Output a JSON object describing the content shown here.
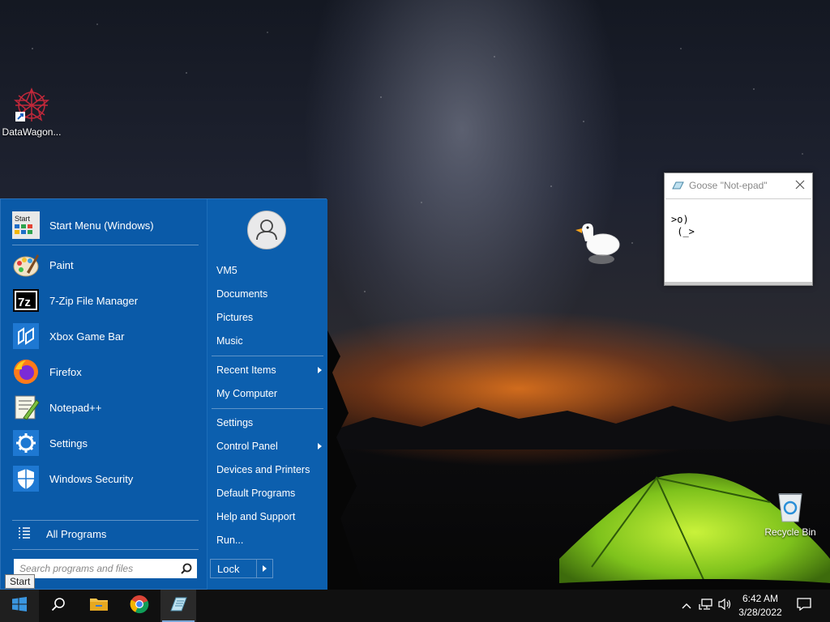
{
  "desktop": {
    "icons": [
      {
        "label": "DataWagon...",
        "icon": "datawagon-icon"
      },
      {
        "label": "Recycle Bin",
        "icon": "recycle-bin-icon"
      }
    ]
  },
  "start_menu": {
    "header": {
      "label": "Start Menu (Windows)",
      "icon_text": "Start"
    },
    "programs": [
      {
        "label": "Paint",
        "icon": "paint-icon"
      },
      {
        "label": "7-Zip File Manager",
        "icon": "7zip-icon",
        "icon_text": "7z"
      },
      {
        "label": "Xbox Game Bar",
        "icon": "xbox-game-bar-icon"
      },
      {
        "label": "Firefox",
        "icon": "firefox-icon"
      },
      {
        "label": "Notepad++",
        "icon": "notepadpp-icon"
      },
      {
        "label": "Settings",
        "icon": "settings-gear-icon"
      },
      {
        "label": "Windows Security",
        "icon": "shield-icon"
      }
    ],
    "all_programs": "All Programs",
    "search_placeholder": "Search programs and files",
    "right": {
      "user": "VM5",
      "group1": [
        "Documents",
        "Pictures",
        "Music"
      ],
      "group2": [
        {
          "label": "Recent Items",
          "submenu": true
        },
        {
          "label": "My Computer",
          "submenu": false
        }
      ],
      "group3": [
        {
          "label": "Settings",
          "submenu": false
        },
        {
          "label": "Control Panel",
          "submenu": true
        },
        {
          "label": "Devices and Printers",
          "submenu": false
        },
        {
          "label": "Default Programs",
          "submenu": false
        },
        {
          "label": "Help and Support",
          "submenu": false
        },
        {
          "label": "Run...",
          "submenu": false
        }
      ],
      "lock": "Lock"
    }
  },
  "tooltip": "Start",
  "notepad": {
    "title": "Goose \"Not-epad\"",
    "content_line1": ">o)",
    "content_line2": " (_>"
  },
  "taskbar": {
    "buttons": [
      "start-button",
      "search-button",
      "file-explorer-button",
      "chrome-button",
      "notepad-button"
    ],
    "clock": {
      "time": "6:42 AM",
      "date": "3/28/2022"
    }
  },
  "colors": {
    "start_menu_bg": "#0a5aa8",
    "taskbar_bg": "#101010",
    "accent": "#7aa7d8"
  }
}
